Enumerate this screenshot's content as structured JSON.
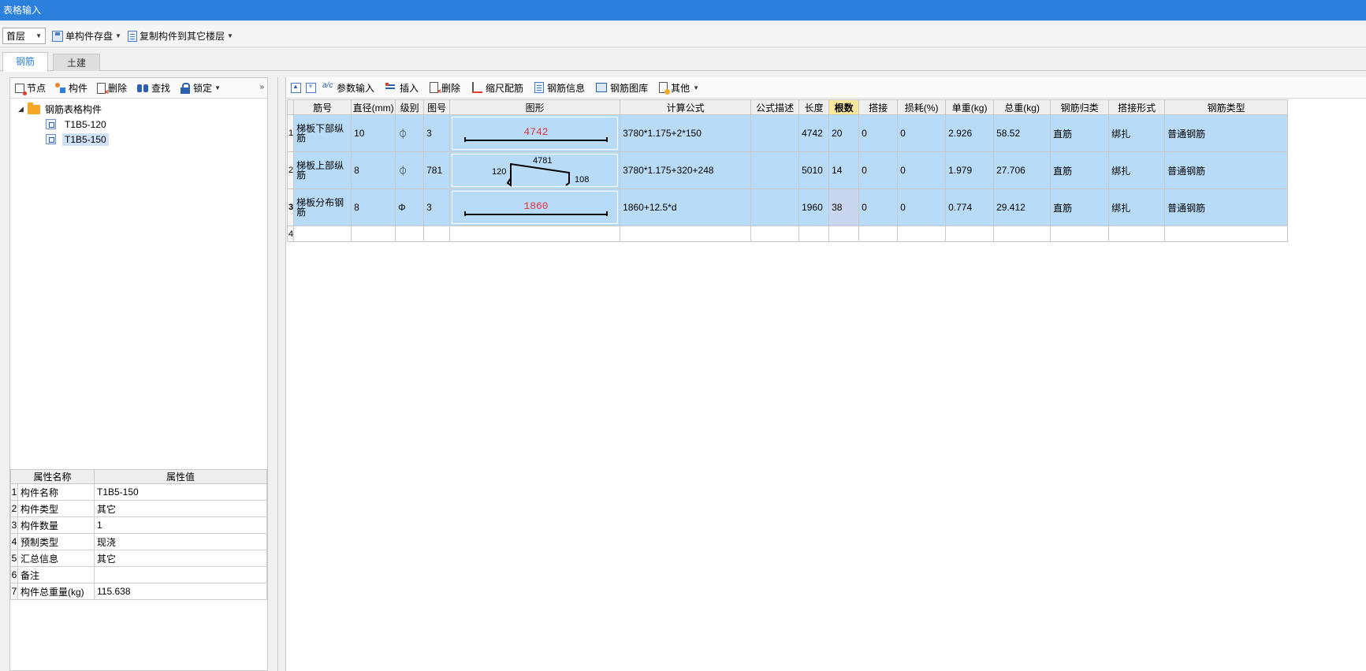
{
  "window": {
    "title": "表格输入"
  },
  "topbar": {
    "floor": "首层",
    "save_label": "单构件存盘",
    "copy_label": "复制构件到其它楼层"
  },
  "tabs": [
    {
      "label": "钢筋"
    },
    {
      "label": "土建"
    }
  ],
  "left_toolbar": {
    "node": "节点",
    "component": "构件",
    "delete": "删除",
    "find": "查找",
    "lock": "锁定"
  },
  "tree": {
    "root": "钢筋表格构件",
    "children": [
      {
        "label": "T1B5-120"
      },
      {
        "label": "T1B5-150"
      }
    ]
  },
  "props": {
    "headers": [
      "属性名称",
      "属性值"
    ],
    "rows": [
      {
        "idx": "1",
        "name": "构件名称",
        "value": "T1B5-150"
      },
      {
        "idx": "2",
        "name": "构件类型",
        "value": "其它"
      },
      {
        "idx": "3",
        "name": "构件数量",
        "value": "1"
      },
      {
        "idx": "4",
        "name": "预制类型",
        "value": "现浇"
      },
      {
        "idx": "5",
        "name": "汇总信息",
        "value": "其它"
      },
      {
        "idx": "6",
        "name": "备注",
        "value": ""
      },
      {
        "idx": "7",
        "name": "构件总重量(kg)",
        "value": "115.638"
      }
    ]
  },
  "right_toolbar": {
    "param_input": "参数输入",
    "insert": "插入",
    "delete": "删除",
    "scale": "缩尺配筋",
    "info": "钢筋信息",
    "library": "钢筋图库",
    "other": "其他"
  },
  "grid": {
    "headers": [
      "筋号",
      "直径(mm)",
      "级别",
      "图号",
      "图形",
      "计算公式",
      "公式描述",
      "长度",
      "根数",
      "搭接",
      "损耗(%)",
      "单重(kg)",
      "总重(kg)",
      "钢筋归类",
      "搭接形式",
      "钢筋类型"
    ],
    "rows": [
      {
        "rn": "1",
        "name": "梯板下部纵筋",
        "dia": "10",
        "grade": "⏀",
        "fig": "3",
        "shape": {
          "main": "4742"
        },
        "formula": "3780*1.175+2*150",
        "desc": "",
        "len": "4742",
        "count": "20",
        "lap": "0",
        "loss": "0",
        "unit_w": "2.926",
        "total_w": "58.52",
        "category": "直筋",
        "lap_type": "绑扎",
        "bar_type": "普通钢筋"
      },
      {
        "rn": "2",
        "name": "梯板上部纵筋",
        "dia": "8",
        "grade": "⏀",
        "fig": "781",
        "shape": {
          "left": "120",
          "top": "4781",
          "right": "108"
        },
        "formula": "3780*1.175+320+248",
        "desc": "",
        "len": "5010",
        "count": "14",
        "lap": "0",
        "loss": "0",
        "unit_w": "1.979",
        "total_w": "27.706",
        "category": "直筋",
        "lap_type": "绑扎",
        "bar_type": "普通钢筋"
      },
      {
        "rn": "3",
        "name": "梯板分布钢筋",
        "dia": "8",
        "grade": "Φ",
        "fig": "3",
        "shape": {
          "main": "1860"
        },
        "formula": "1860+12.5*d",
        "desc": "",
        "len": "1960",
        "count": "38",
        "lap": "0",
        "loss": "0",
        "unit_w": "0.774",
        "total_w": "29.412",
        "category": "直筋",
        "lap_type": "绑扎",
        "bar_type": "普通钢筋"
      }
    ],
    "empty_row": "4"
  }
}
